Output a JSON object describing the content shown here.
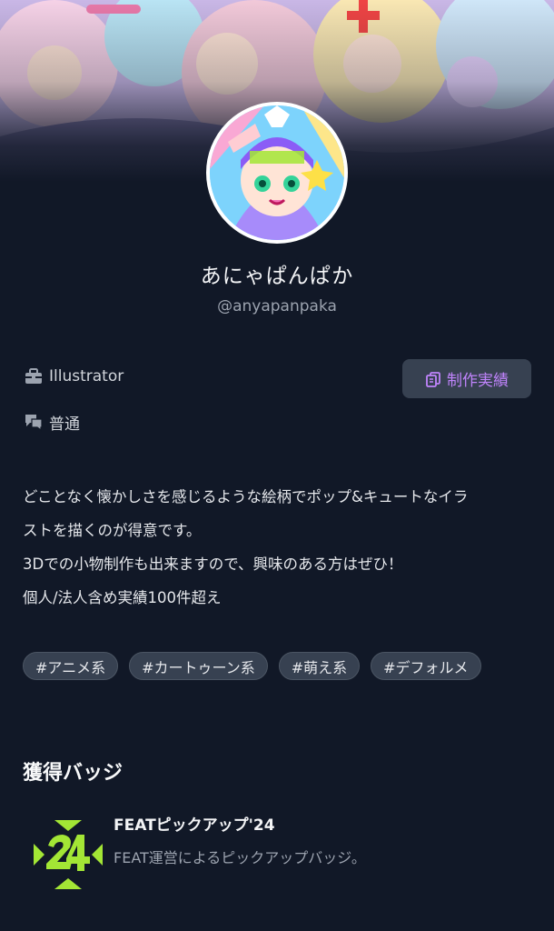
{
  "profile": {
    "display_name": "あにゃぱんぱか",
    "handle": "@anyapanpaka",
    "occupation": "Illustrator",
    "response_speed": "普通",
    "works_button_label": "制作実績"
  },
  "bio": {
    "lines": [
      "どことなく懐かしさを感じるような絵柄でポップ&キュートなイラ",
      "ストを描くのが得意です。",
      "3Dでの小物制作も出来ますので、興味のある方はぜひ！",
      "個人/法人含め実績100件超え"
    ]
  },
  "tags": [
    "#アニメ系",
    "#カートゥーン系",
    "#萌え系",
    "#デフォルメ"
  ],
  "badges_section": {
    "title": "獲得バッジ",
    "badges": [
      {
        "name": "FEATピックアップ'24",
        "description": "FEAT運営によるピックアップバッジ。",
        "color": "#a3e635"
      }
    ]
  },
  "colors": {
    "background": "#111827",
    "accent": "#c084fc",
    "chip_bg": "#374151",
    "badge_green": "#a3e635"
  },
  "icons": {
    "occupation": "briefcase-icon",
    "response": "chat-bubbles-icon",
    "works": "documents-icon"
  }
}
